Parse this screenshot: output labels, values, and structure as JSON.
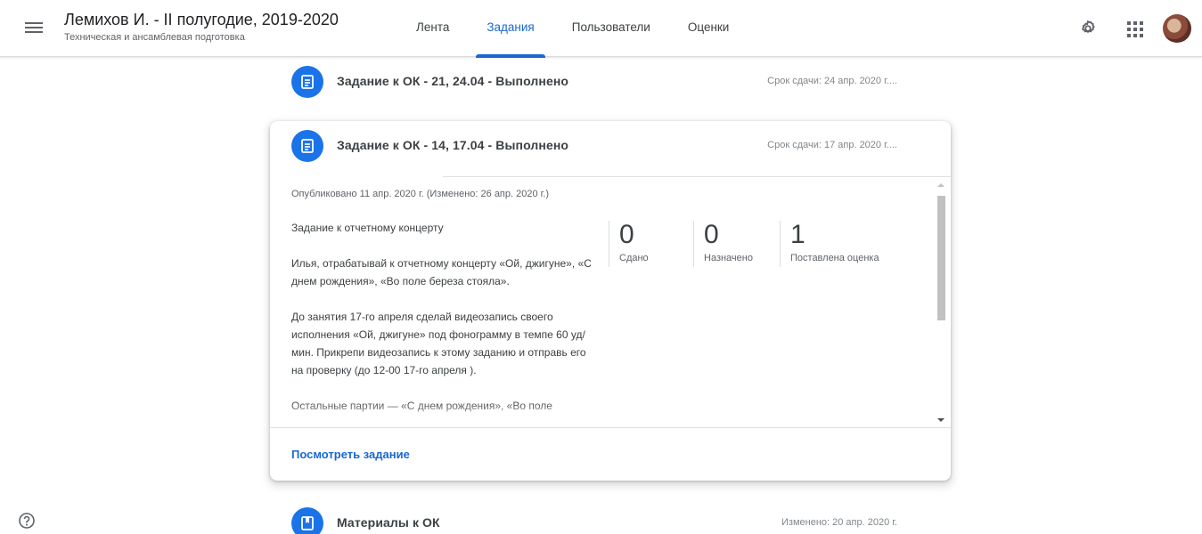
{
  "header": {
    "title": "Лемихов И. - II полугодие, 2019-2020",
    "subtitle": "Техническая и ансамблевая подготовка",
    "tabs": [
      {
        "label": "Лента",
        "active": false
      },
      {
        "label": "Задания",
        "active": true
      },
      {
        "label": "Пользователи",
        "active": false
      },
      {
        "label": "Оценки",
        "active": false
      }
    ],
    "icons": [
      "menu-icon",
      "gear-icon",
      "apps-icon",
      "avatar"
    ]
  },
  "stream": {
    "items": [
      {
        "type": "assignment",
        "icon": "assignment-icon",
        "title": "Задание к ОК - 21, 24.04 - Выполнено",
        "meta": "Срок сдачи: 24 апр. 2020 г...."
      },
      {
        "type": "material",
        "icon": "material-icon",
        "title": "Материалы к ОК",
        "meta": "Изменено: 20 апр. 2020 г."
      }
    ],
    "expanded": {
      "icon": "assignment-icon",
      "title": "Задание к ОК - 14, 17.04 - Выполнено",
      "meta": "Срок сдачи: 17 апр. 2020 г....",
      "published": "Опубликовано 11 апр. 2020 г. (Изменено: 26 апр. 2020 г.)",
      "description": [
        "Задание к отчетному концерту",
        "Илья, отрабатывай к отчетному концерту «Ой, джигуне», «С днем рождения», «Во поле береза стояла».",
        "До занятия 17-го апреля сделай видеозапись своего исполнения «Ой, джигуне» под фонограмму в темпе 60 уд/мин. Прикрепи видеозапись к этому заданию и отправь его на проверку (до 12-00 17-го апреля ).",
        "Остальные партии — «С днем рождения», «Во поле"
      ],
      "stats": [
        {
          "value": "0",
          "label": "Сдано"
        },
        {
          "value": "0",
          "label": "Назначено"
        },
        {
          "value": "1",
          "label": "Поставлена оценка"
        }
      ],
      "view_link": "Посмотреть задание"
    }
  },
  "colors": {
    "accent": "#1967d2",
    "icon_bg": "#1a73e8"
  }
}
